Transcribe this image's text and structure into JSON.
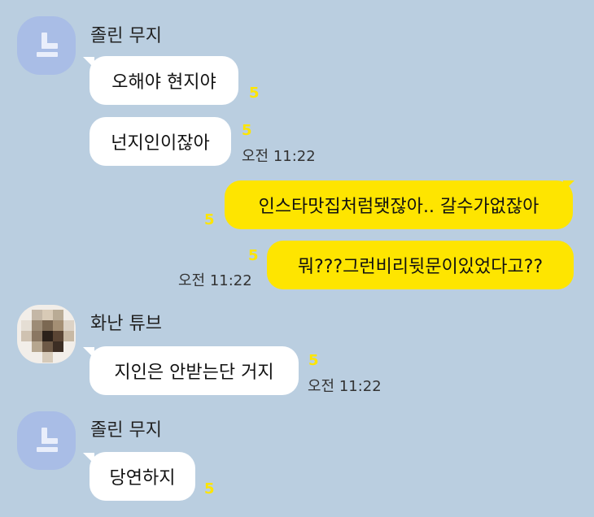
{
  "messages": [
    {
      "sender": "졸린 무지",
      "text": "오해야 현지야",
      "unread": "5"
    },
    {
      "text": "넌지인이잖아",
      "unread": "5",
      "time": "오전 11:22"
    },
    {
      "text": "인스타맛집처럼됏잖아.. 갈수가없잖아",
      "unread": "5"
    },
    {
      "text": "뭐???그런비리뒷문이있었다고??",
      "unread": "5",
      "time": "오전 11:22"
    },
    {
      "sender": "화난 튜브",
      "text": "지인은 안받는단 거지",
      "unread": "5",
      "time": "오전 11:22"
    },
    {
      "sender": "졸린 무지",
      "text": "당연하지",
      "unread": "5"
    }
  ],
  "colors": {
    "background": "#bacee0",
    "incoming_bubble": "#ffffff",
    "outgoing_bubble": "#fee500",
    "unread_count": "#fee500",
    "avatar_default": "#a9bde6"
  }
}
